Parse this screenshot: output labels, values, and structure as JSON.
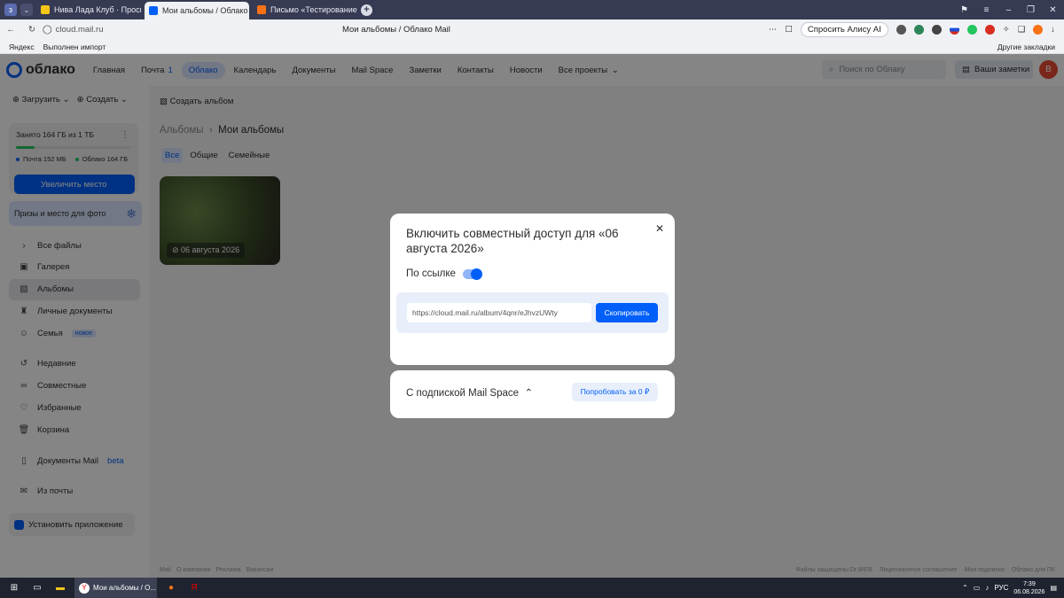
{
  "browser": {
    "tabs": [
      {
        "title": "Нива Лада Клуб · Просм",
        "active": false,
        "color": "#f5c518"
      },
      {
        "title": "Мои альбомы / Облако",
        "active": true,
        "color": "#005ff9"
      },
      {
        "title": "Письмо «Тестирование»",
        "active": false,
        "color": "#f97316"
      }
    ],
    "url": "cloud.mail.ru",
    "page_title": "Мои альбомы / Облако Mail",
    "ask_alisa": "Спросить Алису AI",
    "bookmarks": {
      "yandex": "Яндекс",
      "import": "Выполнен импорт",
      "other": "Другие закладки"
    }
  },
  "header": {
    "logo": "облако",
    "menu": [
      {
        "label": "Главная",
        "active": false
      },
      {
        "label": "Почта",
        "count": "1",
        "active": false
      },
      {
        "label": "Облако",
        "active": true
      },
      {
        "label": "Календарь",
        "active": false
      },
      {
        "label": "Документы",
        "active": false
      },
      {
        "label": "Mail Space",
        "active": false
      },
      {
        "label": "Заметки",
        "active": false
      },
      {
        "label": "Контакты",
        "active": false
      },
      {
        "label": "Новости",
        "active": false
      },
      {
        "label": "Все проекты",
        "active": false
      }
    ],
    "search_placeholder": "Поиск по Облаку",
    "notes": "Ваши заметки",
    "avatar_letter": "В"
  },
  "sidebar": {
    "upload": "Загрузить",
    "create": "Создать",
    "storage": {
      "used": "Занято 164 ГБ из 1 ТБ",
      "mail": "Почта 152 МБ",
      "cloud": "Облако 164 ГБ",
      "used_percent": 16
    },
    "increase": "Увеличить место",
    "prizes": "Призы и место для фото",
    "items": [
      {
        "label": "Все файлы",
        "icon": "chevron-right-icon"
      },
      {
        "label": "Галерея",
        "icon": "gallery-icon"
      },
      {
        "label": "Альбомы",
        "icon": "album-icon",
        "active": true
      },
      {
        "label": "Личные документы",
        "icon": "documents-icon"
      },
      {
        "label": "Семья",
        "icon": "family-icon",
        "badge": "новое"
      },
      {
        "label": "Недавние",
        "icon": "history-icon"
      },
      {
        "label": "Совместные",
        "icon": "link-icon"
      },
      {
        "label": "Избранные",
        "icon": "heart-icon"
      },
      {
        "label": "Корзина",
        "icon": "trash-icon"
      },
      {
        "label": "Документы Mail",
        "icon": "doc-mail-icon",
        "badge_text": "beta"
      },
      {
        "label": "Из почты",
        "icon": "mail-icon"
      }
    ],
    "install": "Установить приложение"
  },
  "main": {
    "create_album": "Создать альбом",
    "breadcrumb_root": "Альбомы",
    "breadcrumb_current": "Мои альбомы",
    "filters": [
      {
        "label": "Все",
        "active": true
      },
      {
        "label": "Общие",
        "active": false
      },
      {
        "label": "Семейные",
        "active": false
      }
    ],
    "album_title": "06 августа 2026",
    "footer_left": [
      "Mail",
      "О компании",
      "Реклама",
      "Вакансии"
    ],
    "footer_right": [
      "Файлы защищены Dr.WEB",
      "Лицензионное соглашение",
      "Мои подписки",
      "Облако для ПК"
    ]
  },
  "modal": {
    "title": "Включить совместный доступ для «06 августа 2026»",
    "by_link": "По ссылке",
    "link": "https://cloud.mail.ru/album/4qnr/eJhvzUWty",
    "copy": "Скопировать",
    "subscription": "С подпиской Mail Space",
    "try": "Попробовать за 0 ₽"
  },
  "taskbar": {
    "app": "Мои альбомы / О...",
    "lang": "РУС",
    "time": "7:39",
    "date": "06.08.2026"
  }
}
